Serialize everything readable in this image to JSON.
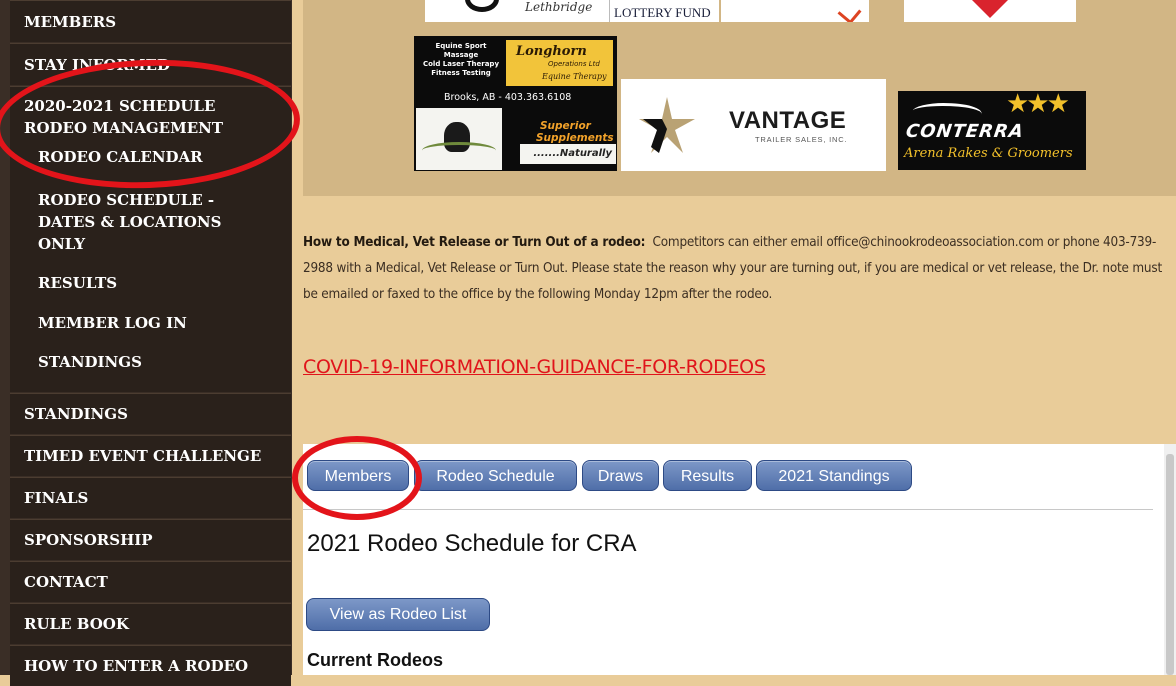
{
  "sidebar": {
    "items": [
      {
        "label": "MEMBERS"
      },
      {
        "label": "STAY INFORMED"
      },
      {
        "label": "2020-2021 SCHEDULE"
      },
      {
        "label": "RODEO MANAGEMENT"
      },
      {
        "label": "STANDINGS"
      },
      {
        "label": "TIMED EVENT CHALLENGE"
      },
      {
        "label": "FINALS"
      },
      {
        "label": "SPONSORSHIP"
      },
      {
        "label": "CONTACT"
      },
      {
        "label": "RULE BOOK"
      },
      {
        "label": "HOW TO ENTER A RODEO"
      }
    ],
    "sub_items": [
      {
        "label": "RODEO CALENDAR"
      },
      {
        "label": "RODEO SCHEDULE -DATES & LOCATIONS ONLY"
      },
      {
        "label": "RESULTS"
      },
      {
        "label": "MEMBER LOG IN"
      },
      {
        "label": "STANDINGS"
      }
    ]
  },
  "sponsors": {
    "lethbridge_text": "Lethbridge",
    "lottery_text": "LOTTERY FUND",
    "longhorn": {
      "line1": "Equine Sport Massage",
      "line2": "Cold Laser Therapy",
      "line3": "Fitness Testing",
      "brand": "Longhorn",
      "brand_sub": "Operations Ltd",
      "brand_sub2": "Equine Therapy",
      "phone": "Brooks, AB - 403.363.6108",
      "superior": "Superior",
      "supplements": "Supplements",
      "naturally": ".......Naturally"
    },
    "vantage": {
      "name": "VANTAGE",
      "sub": "TRAILER SALES, INC."
    },
    "conterra": {
      "name": "CONTERRA",
      "sub": "Arena Rakes & Groomers"
    }
  },
  "info": {
    "heading": "How to Medical, Vet Release or Turn Out of a rodeo:",
    "body": "Competitors can either email office@chinookrodeoassociation.com or phone 403-739-2988 with a Medical, Vet Release or Turn Out.  Please state the reason why your are turning out, if you are medical or vet release, the Dr. note must be emailed or faxed to the office by the following Monday 12pm after the rodeo.",
    "covid_link": "COVID-19-INFORMATION-GUIDANCE-FOR-RODEOS"
  },
  "tabs": [
    {
      "label": "Members"
    },
    {
      "label": "Rodeo Schedule"
    },
    {
      "label": "Draws"
    },
    {
      "label": "Results"
    },
    {
      "label": "2021 Standings"
    }
  ],
  "main": {
    "title": "2021 Rodeo Schedule for CRA",
    "list_button": "View as Rodeo List",
    "current_heading": "Current Rodeos"
  },
  "colors": {
    "sidebar_bg": "#2a211b",
    "page_bg": "#e9cc99",
    "sponsor_bg": "#d2b685",
    "tab_blue": "#5a78b0",
    "covid_red": "#e0141b",
    "annotation_red": "#e3141a"
  }
}
